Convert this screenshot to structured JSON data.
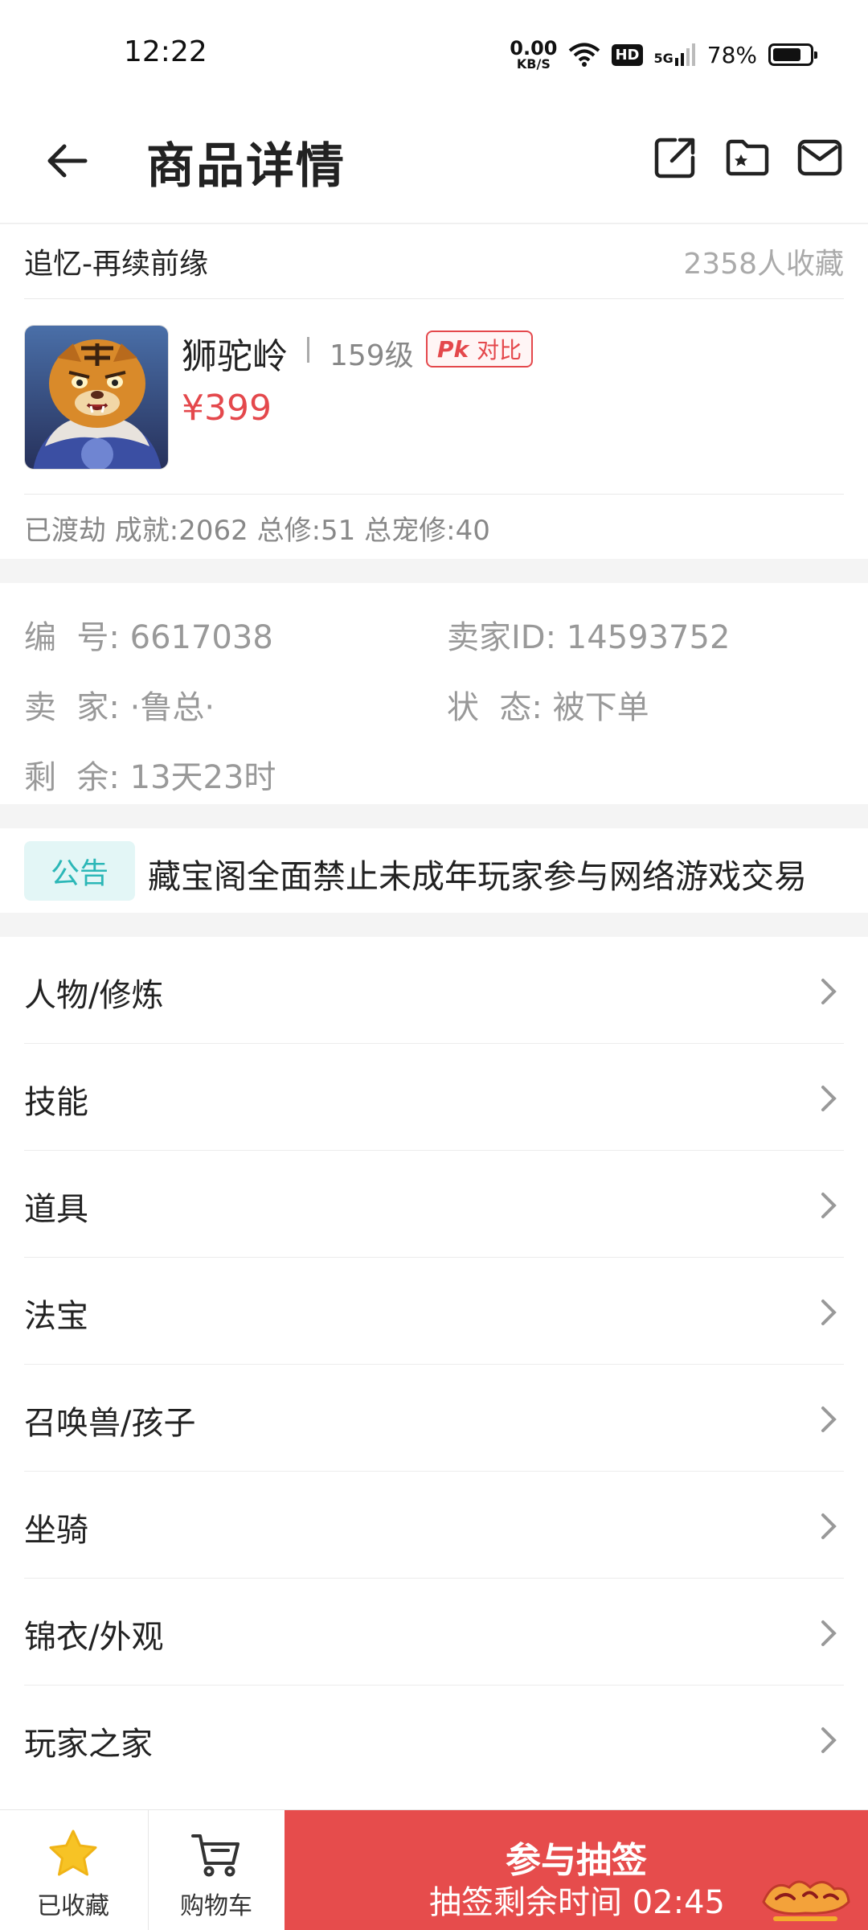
{
  "status_bar": {
    "time": "12:22",
    "net_speed_value": "0.00",
    "net_speed_unit": "KB/S",
    "hd_label": "HD",
    "network_label": "5G",
    "battery_percent": "78%",
    "battery_level": 0.78
  },
  "header": {
    "title": "商品详情",
    "icons": [
      "back-arrow-icon",
      "share-icon",
      "collection-folder-icon",
      "mail-icon"
    ]
  },
  "product": {
    "server": "追忆-再续前缘",
    "favorites": "2358人收藏",
    "school": "狮驼岭",
    "level": "159级",
    "pk_label": "Pk",
    "compare_label": "对比",
    "price": "¥399",
    "summary": "已渡劫 成就:2062 总修:51 总宠修:40"
  },
  "info": {
    "id_label": "编  号:",
    "id_value": "6617038",
    "seller_id_label": "卖家ID:",
    "seller_id_value": "14593752",
    "seller_label": "卖  家:",
    "seller_value": "·鲁总·",
    "status_label": "状  态:",
    "status_value": "被下单",
    "remaining_label": "剩  余:",
    "remaining_value": "13天23时"
  },
  "notice": {
    "tag": "公告",
    "text": "藏宝阁全面禁止未成年玩家参与网络游戏交易"
  },
  "menu": {
    "items": [
      {
        "label": "人物/修炼"
      },
      {
        "label": "技能"
      },
      {
        "label": "道具"
      },
      {
        "label": "法宝"
      },
      {
        "label": "召唤兽/孩子"
      },
      {
        "label": "坐骑"
      },
      {
        "label": "锦衣/外观"
      },
      {
        "label": "玩家之家"
      }
    ]
  },
  "bottom_bar": {
    "favorited_label": "已收藏",
    "cart_label": "购物车",
    "lottery_title": "参与抽签",
    "lottery_countdown": "抽签剩余时间 02:45"
  },
  "colors": {
    "accent_red": "#e64c4c",
    "notice_teal": "#2bb7b7",
    "star_yellow": "#f7c325"
  }
}
